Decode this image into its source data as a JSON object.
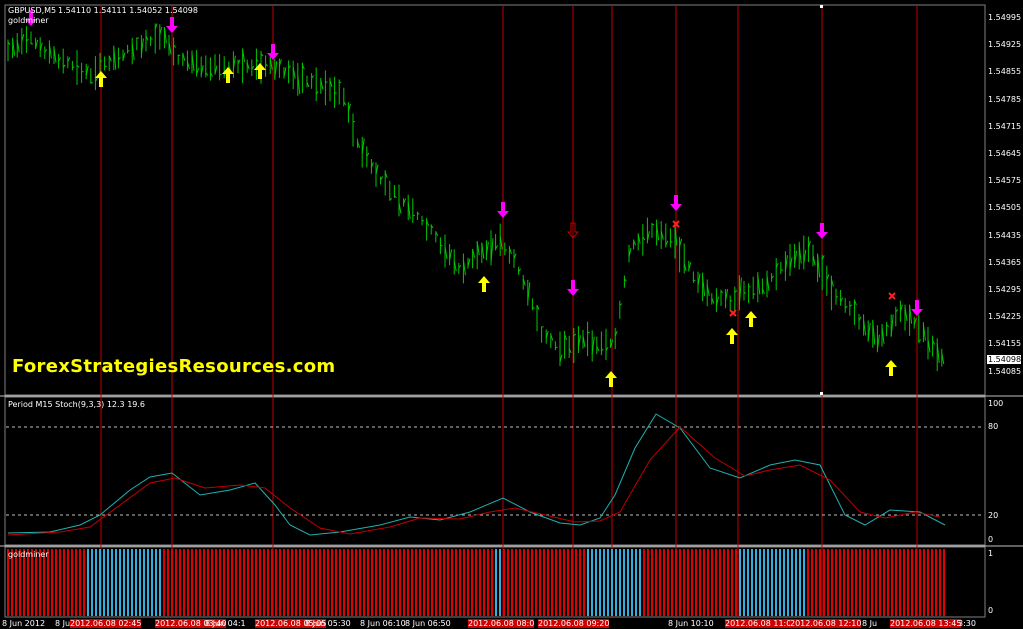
{
  "main_chart": {
    "header_symbol": "GBPUSD,M5",
    "header_ohlc": "1.54110 1.54111 1.54052 1.54098",
    "indicator_name": "goldminer",
    "current_price": "1.54098",
    "price_levels": [
      "1.54995",
      "1.54925",
      "1.54855",
      "1.54785",
      "1.54715",
      "1.54645",
      "1.54575",
      "1.54505",
      "1.54435",
      "1.54365",
      "1.54295",
      "1.54225",
      "1.54155",
      "1.54085"
    ],
    "watermark": "ForexStrategiesResources.com"
  },
  "stoch_panel": {
    "title": "Period M15 Stoch(9,3,3) 12.3 19.6",
    "levels": [
      "100",
      "80",
      "20",
      "0"
    ]
  },
  "goldminer_panel": {
    "title": "goldminer",
    "levels": [
      "1",
      "0"
    ]
  },
  "time_axis": [
    {
      "label": "8 Jun 2012",
      "hl": false
    },
    {
      "label": "8 Jun",
      "hl": false
    },
    {
      "label": "2012.06.08 02:45",
      "hl": true
    },
    {
      "label": "2012.06.08 03:40",
      "hl": true
    },
    {
      "label": "8 Jun 04:1",
      "hl": false
    },
    {
      "label": "2012.06.08 05:05",
      "hl": true
    },
    {
      "label": "8 Jun 05:30",
      "hl": false
    },
    {
      "label": "8 Jun 06:10",
      "hl": false
    },
    {
      "label": "8 Jun 06:50",
      "hl": false
    },
    {
      "label": "2012.06.08 08:0",
      "hl": true
    },
    {
      "label": "2012.06.08 09:20",
      "hl": true
    },
    {
      "label": "8 Jun 10:10",
      "hl": false
    },
    {
      "label": "2012.06.08 11:05",
      "hl": true
    },
    {
      "label": "2012.06.08 12:10",
      "hl": true
    },
    {
      "label": "8 Ju",
      "hl": false
    },
    {
      "label": "2012.06.08 13:45",
      "hl": true
    },
    {
      "label": "3:30",
      "hl": false
    }
  ],
  "colors": {
    "candle": "#00c800",
    "vline": "#c00000",
    "arrow_up": "#ffff00",
    "arrow_down": "#ff00ff",
    "stoch_main": "#20b0b0",
    "stoch_signal": "#c00000",
    "gm_red": "#e00000",
    "gm_blue": "#30b0e0"
  }
}
